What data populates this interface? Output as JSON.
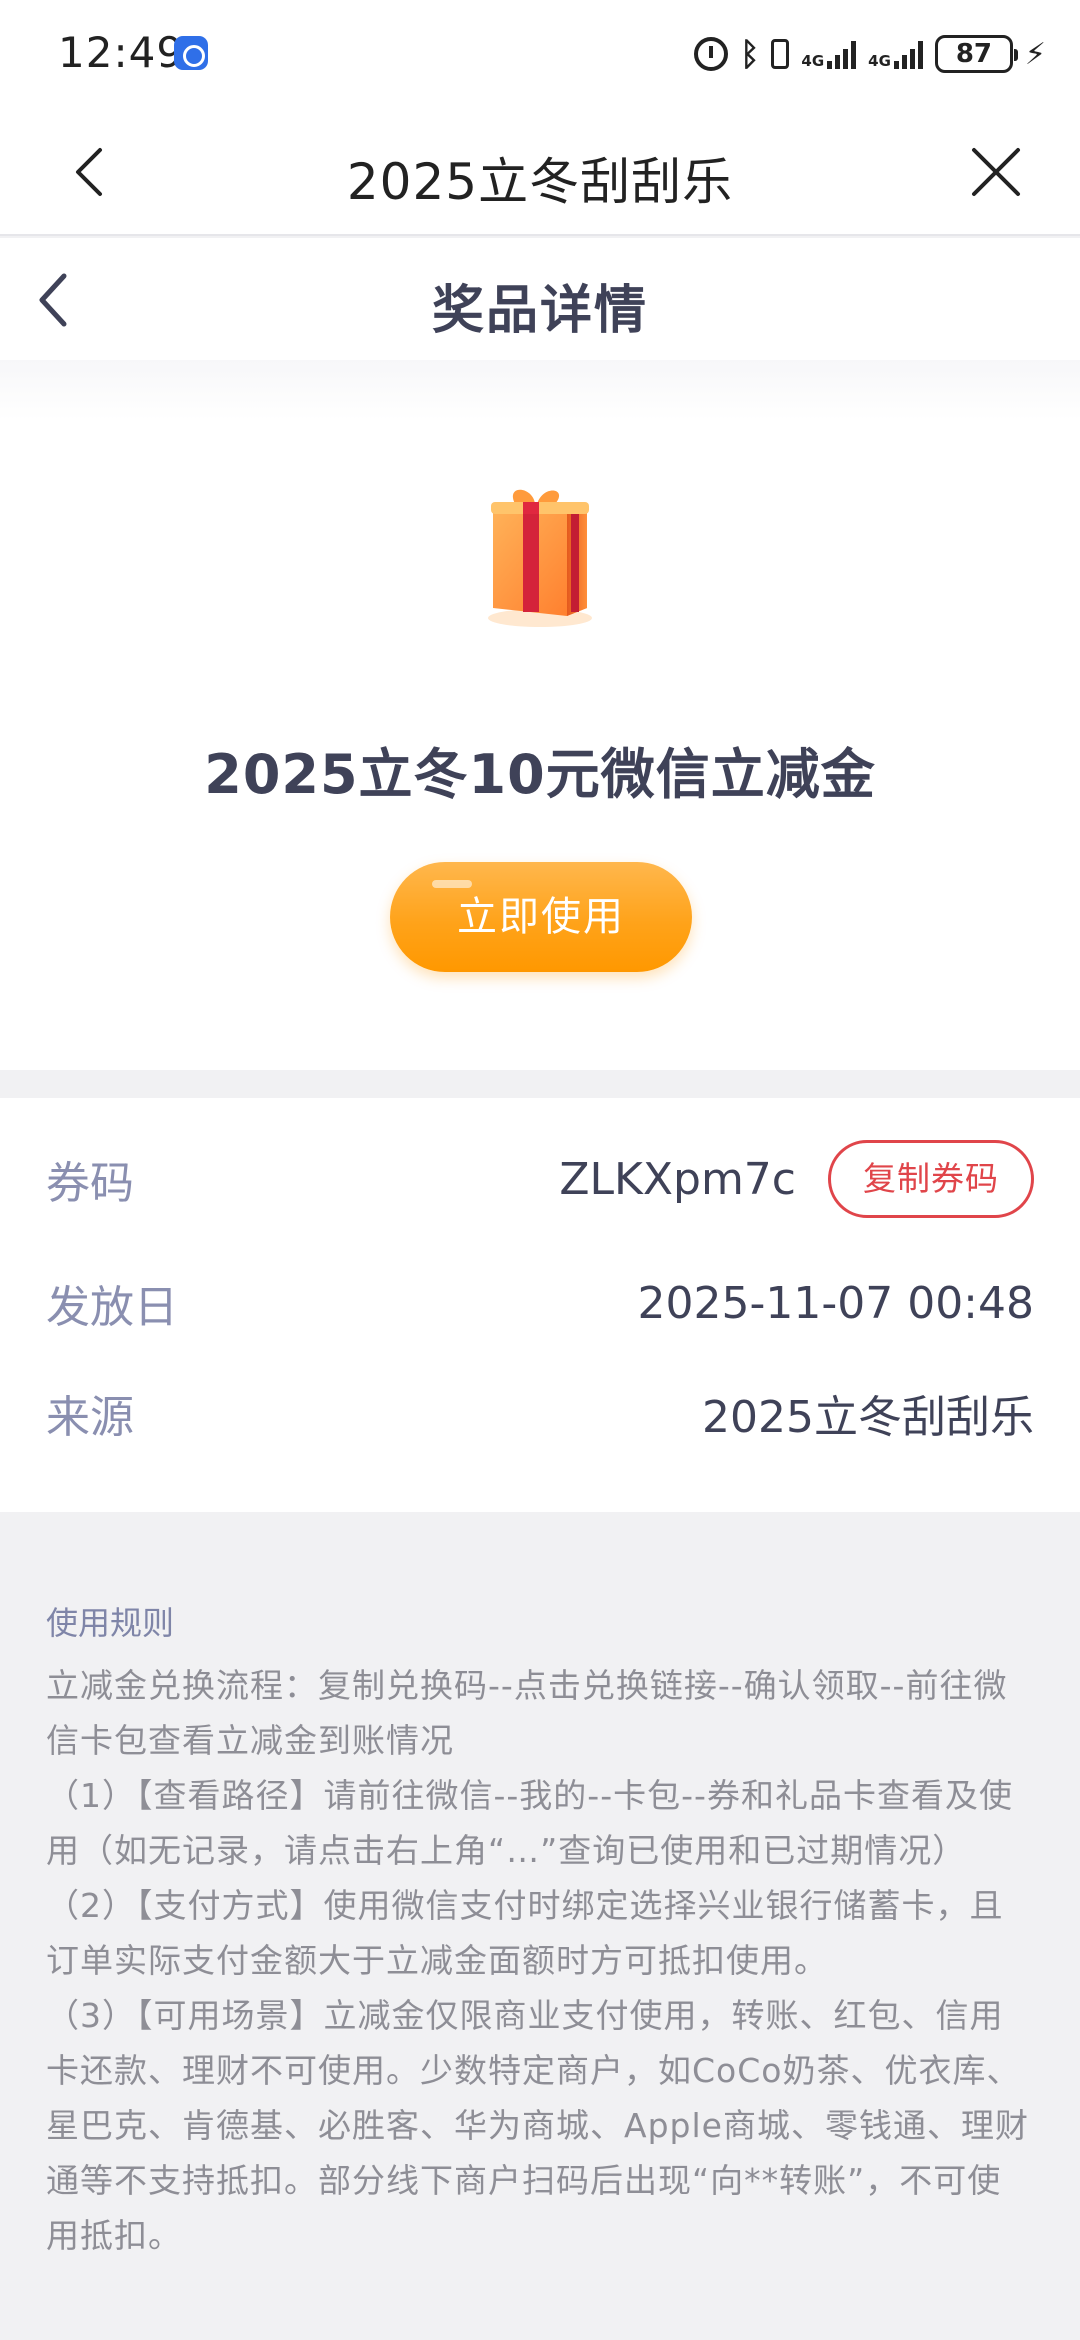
{
  "status_bar": {
    "time": "12:49",
    "network_1": "4G",
    "network_2": "4G",
    "battery": "87",
    "icons": [
      "app-icon",
      "alarm-icon",
      "bluetooth-icon",
      "phone-icon",
      "signal-icon",
      "signal-icon",
      "battery-icon",
      "charging-icon"
    ]
  },
  "title_bar": {
    "title": "2025立冬刮刮乐",
    "back_icon": "chevron-left-icon",
    "close_icon": "close-icon"
  },
  "sub_header": {
    "title": "奖品详情",
    "back_icon": "chevron-left-icon"
  },
  "prize": {
    "icon": "gift-box-icon",
    "name": "2025立冬10元微信立减金",
    "use_button": "立即使用"
  },
  "info": {
    "code_label": "券码",
    "code_value": "ZLKXpm7c",
    "copy_button": "复制券码",
    "issue_label": "发放日",
    "issue_value": "2025-11-07 00:48",
    "source_label": "来源",
    "source_value": "2025立冬刮刮乐"
  },
  "rules": {
    "title": "使用规则",
    "intro": "立减金兑换流程：复制兑换码--点击兑换链接--确认领取--前往微信卡包查看立减金到账情况",
    "item_1": "（1）【查看路径】请前往微信--我的--卡包--券和礼品卡查看及使用（如无记录，请点击右上角“…”查询已使用和已过期情况）",
    "item_2": "（2）【支付方式】使用微信支付时绑定选择兴业银行储蓄卡，且订单实际支付金额大于立减金面额时方可抵扣使用。",
    "item_3": "（3）【可用场景】立减金仅限商业支付使用，转账、红包、信用卡还款、理财不可使用。少数特定商户，如CoCo奶茶、优衣库、星巴克、肯德基、必胜客、华为商城、Apple商城、零钱通、理财通等不支持抵扣。部分线下商户扫码后出现“向**转账”，不可使用抵扣。"
  }
}
